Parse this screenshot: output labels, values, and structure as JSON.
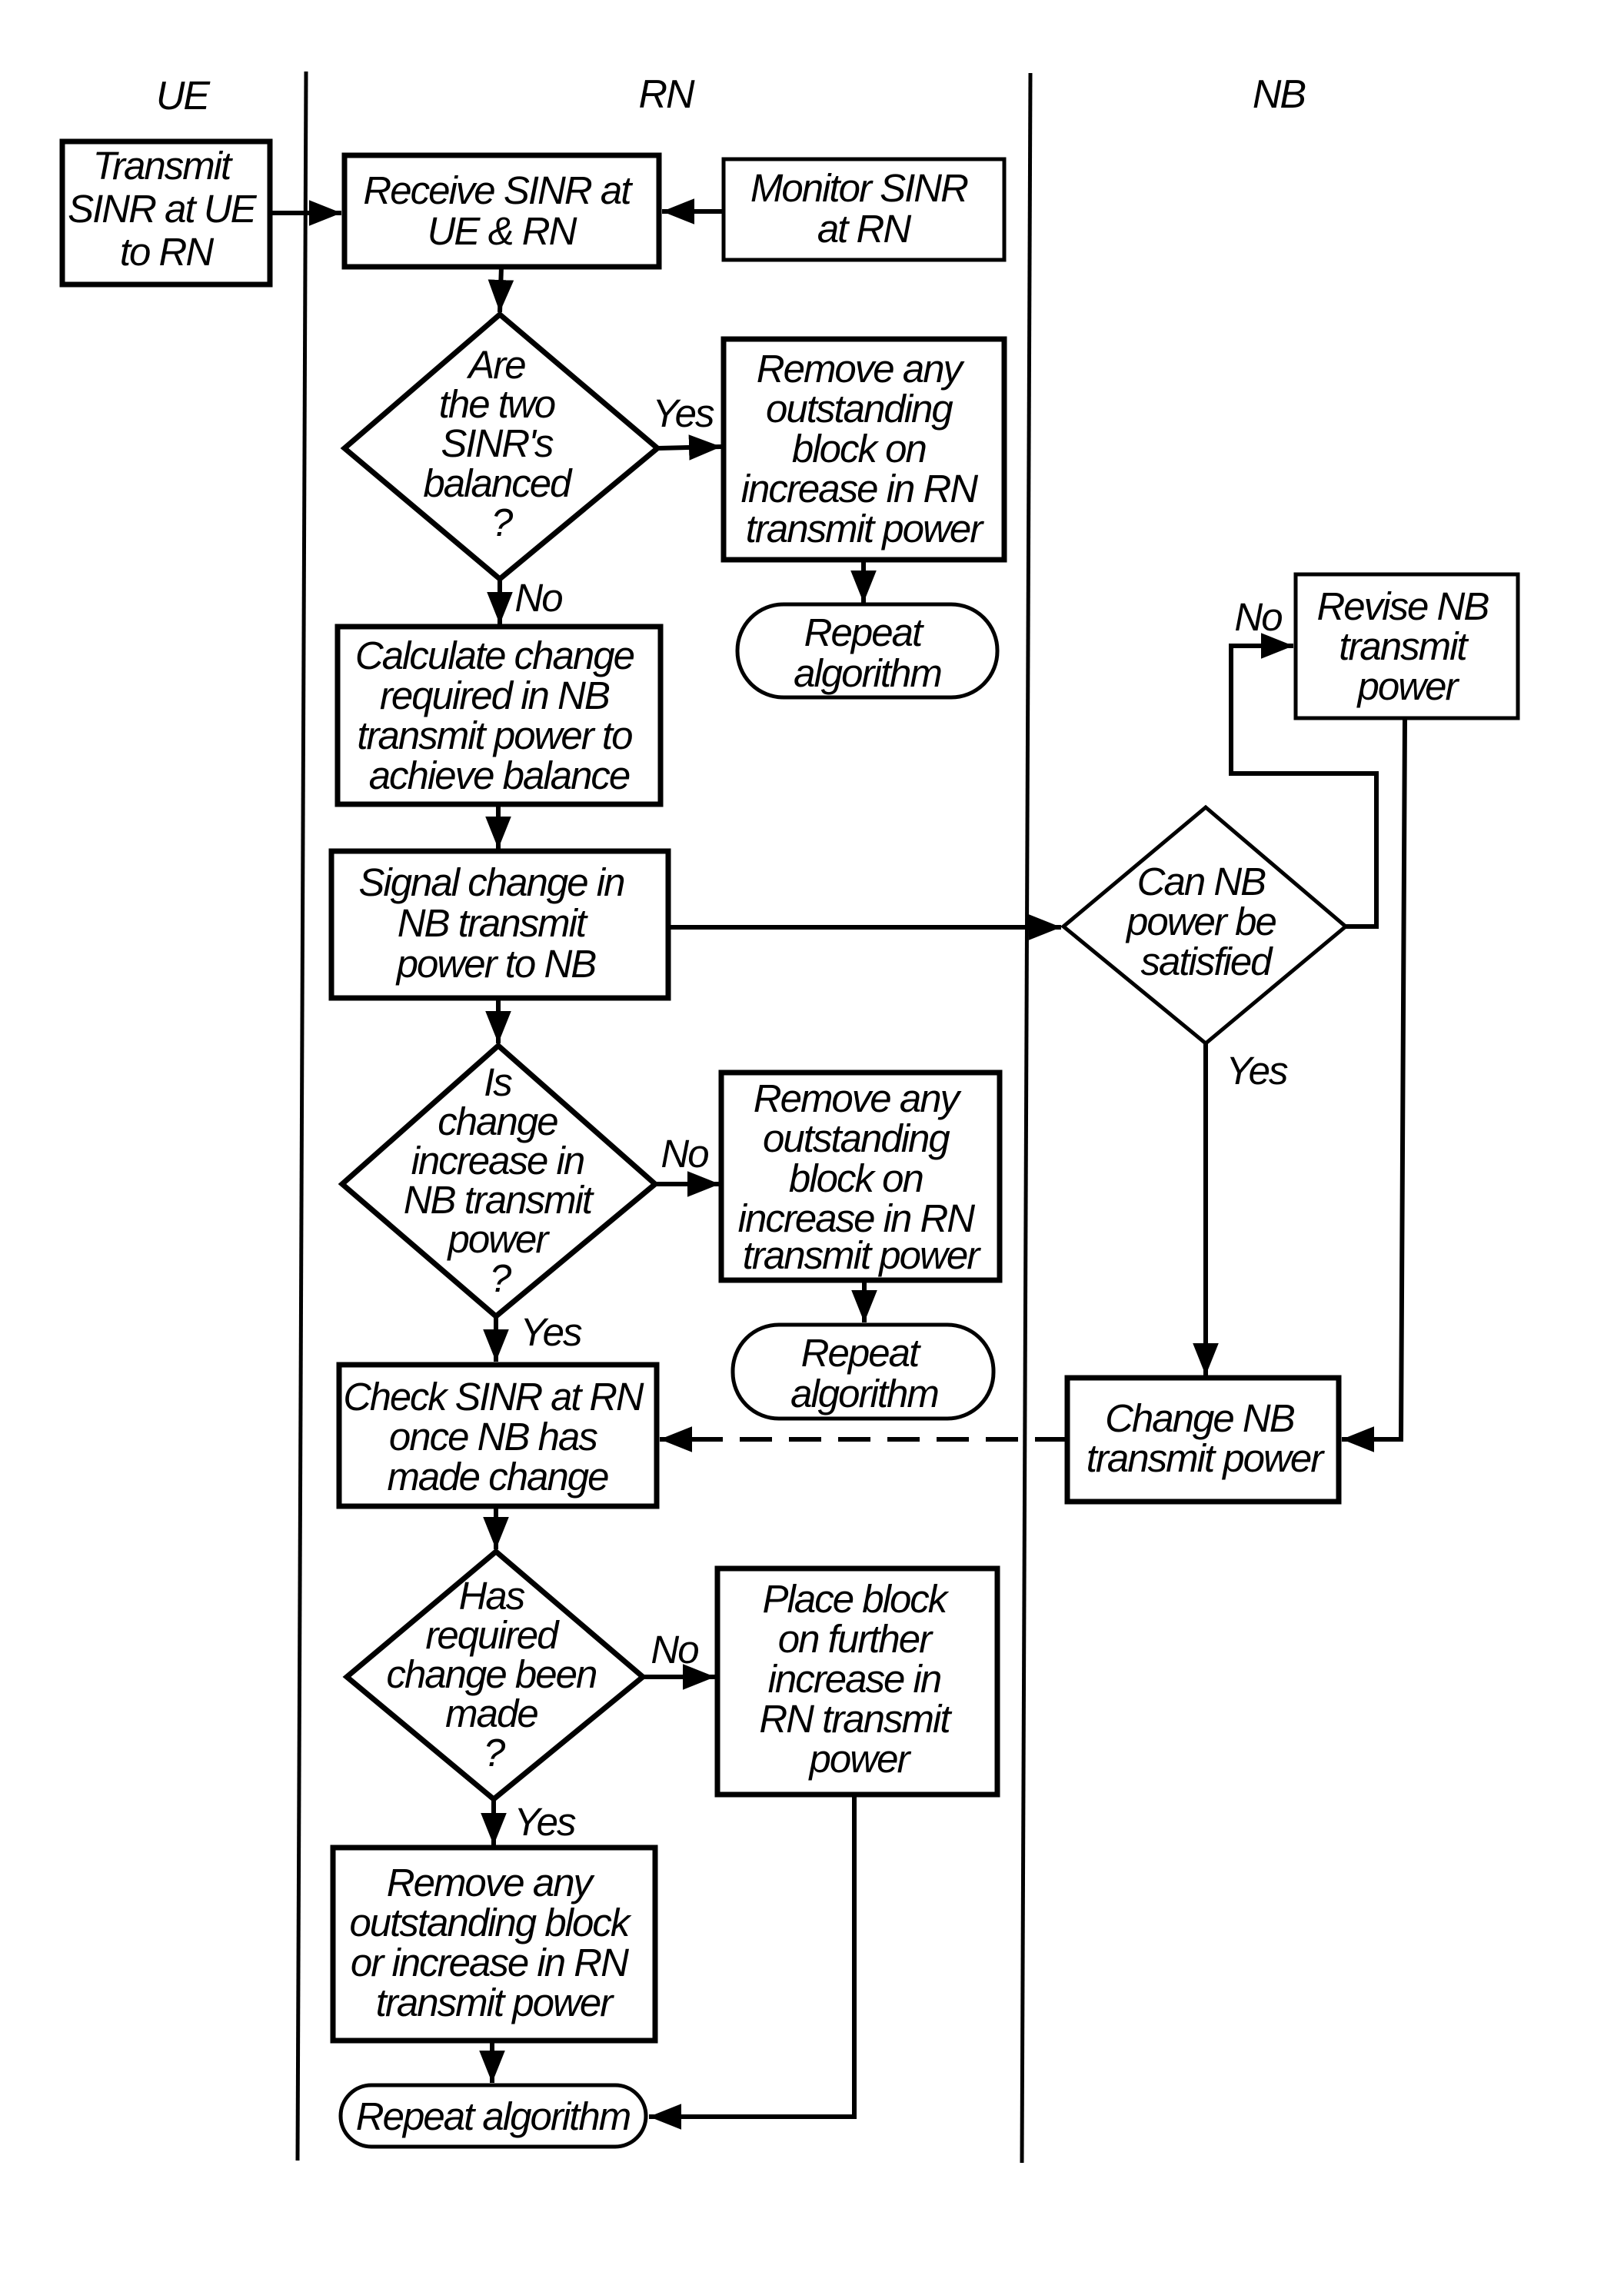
{
  "lanes": [
    {
      "id": "ue",
      "label": "UE"
    },
    {
      "id": "rn",
      "label": "RN"
    },
    {
      "id": "nb",
      "label": "NB"
    }
  ],
  "nodes": {
    "transmit_sinr": {
      "type": "process",
      "lane": "UE",
      "lines": [
        "Transmit",
        "SINR at UE",
        "to RN"
      ]
    },
    "receive_sinr": {
      "type": "process",
      "lane": "RN",
      "lines": [
        "Receive SINR at",
        "UE & RN"
      ]
    },
    "monitor_sinr": {
      "type": "process",
      "lane": "RN",
      "lines": [
        "Monitor SINR",
        "at RN"
      ]
    },
    "balanced_decision": {
      "type": "decision",
      "lane": "RN",
      "lines": [
        "Are",
        "the two",
        "SINR's",
        "balanced",
        "?"
      ]
    },
    "remove_block_1": {
      "type": "process",
      "lane": "RN",
      "lines": [
        "Remove any",
        "outstanding",
        "block on",
        "increase in RN",
        "transmit power"
      ]
    },
    "repeat_1": {
      "type": "terminal",
      "lane": "RN",
      "lines": [
        "Repeat",
        "algorithm"
      ]
    },
    "calculate_change": {
      "type": "process",
      "lane": "RN",
      "lines": [
        "Calculate change",
        "required in NB",
        "transmit power to",
        "achieve balance"
      ]
    },
    "signal_change": {
      "type": "process",
      "lane": "RN",
      "lines": [
        "Signal change in",
        "NB transmit",
        "power to NB"
      ]
    },
    "increase_decision": {
      "type": "decision",
      "lane": "RN",
      "lines": [
        "Is",
        "change",
        "increase in",
        "NB transmit",
        "power",
        "?"
      ]
    },
    "remove_block_2": {
      "type": "process",
      "lane": "RN",
      "lines": [
        "Remove any",
        "outstanding",
        "block on",
        "increase in RN",
        "transmit power"
      ]
    },
    "repeat_2": {
      "type": "terminal",
      "lane": "RN",
      "lines": [
        "Repeat",
        "algorithm"
      ]
    },
    "check_sinr": {
      "type": "process",
      "lane": "RN",
      "lines": [
        "Check SINR at RN",
        "once NB has",
        "made change"
      ]
    },
    "made_decision": {
      "type": "decision",
      "lane": "RN",
      "lines": [
        "Has",
        "required",
        "change been",
        "made",
        "?"
      ]
    },
    "place_block": {
      "type": "process",
      "lane": "RN",
      "lines": [
        "Place block",
        "on further",
        "increase in",
        "RN transmit",
        "power"
      ]
    },
    "remove_block_3": {
      "type": "process",
      "lane": "RN",
      "lines": [
        "Remove any",
        "outstanding block",
        "or increase in RN",
        "transmit power"
      ]
    },
    "repeat_3": {
      "type": "terminal",
      "lane": "RN",
      "lines": [
        "Repeat algorithm"
      ]
    },
    "revise_nb": {
      "type": "process",
      "lane": "NB",
      "lines": [
        "Revise NB",
        "transmit",
        "power"
      ]
    },
    "satisfied_decision": {
      "type": "decision",
      "lane": "NB",
      "lines": [
        "Can NB",
        "power be",
        "satisfied"
      ]
    },
    "change_nb": {
      "type": "process",
      "lane": "NB",
      "lines": [
        "Change NB",
        "transmit power"
      ]
    }
  },
  "edge_labels": {
    "balanced_yes": "Yes",
    "balanced_no": "No",
    "increase_no": "No",
    "increase_yes": "Yes",
    "made_no": "No",
    "made_yes": "Yes",
    "satisfied_no": "No",
    "satisfied_yes": "Yes"
  },
  "edges": [
    {
      "from": "transmit_sinr",
      "to": "receive_sinr",
      "style": "solid"
    },
    {
      "from": "monitor_sinr",
      "to": "receive_sinr",
      "style": "solid"
    },
    {
      "from": "receive_sinr",
      "to": "balanced_decision",
      "style": "solid"
    },
    {
      "from": "balanced_decision",
      "to": "remove_block_1",
      "label": "Yes",
      "style": "solid"
    },
    {
      "from": "remove_block_1",
      "to": "repeat_1",
      "style": "solid"
    },
    {
      "from": "balanced_decision",
      "to": "calculate_change",
      "label": "No",
      "style": "solid"
    },
    {
      "from": "calculate_change",
      "to": "signal_change",
      "style": "solid"
    },
    {
      "from": "signal_change",
      "to": "satisfied_decision",
      "style": "solid"
    },
    {
      "from": "satisfied_decision",
      "to": "revise_nb",
      "label": "No",
      "style": "solid"
    },
    {
      "from": "satisfied_decision",
      "to": "change_nb",
      "label": "Yes",
      "style": "solid"
    },
    {
      "from": "revise_nb",
      "to": "change_nb",
      "style": "solid"
    },
    {
      "from": "signal_change",
      "to": "increase_decision",
      "style": "solid"
    },
    {
      "from": "increase_decision",
      "to": "remove_block_2",
      "label": "No",
      "style": "solid"
    },
    {
      "from": "remove_block_2",
      "to": "repeat_2",
      "style": "solid"
    },
    {
      "from": "increase_decision",
      "to": "check_sinr",
      "label": "Yes",
      "style": "solid"
    },
    {
      "from": "change_nb",
      "to": "check_sinr",
      "style": "dashed"
    },
    {
      "from": "check_sinr",
      "to": "made_decision",
      "style": "solid"
    },
    {
      "from": "made_decision",
      "to": "place_block",
      "label": "No",
      "style": "solid"
    },
    {
      "from": "made_decision",
      "to": "remove_block_3",
      "label": "Yes",
      "style": "solid"
    },
    {
      "from": "remove_block_3",
      "to": "repeat_3",
      "style": "solid"
    },
    {
      "from": "place_block",
      "to": "repeat_3",
      "style": "solid"
    }
  ]
}
